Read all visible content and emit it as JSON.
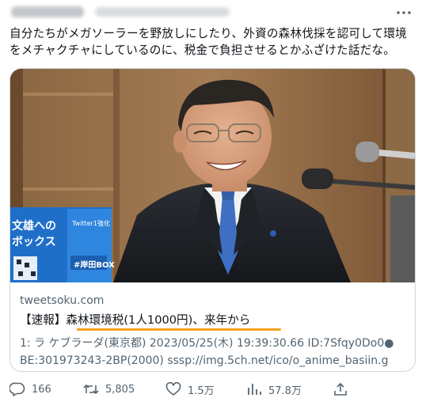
{
  "tweet": {
    "text": "自分たちがメガソーラーを野放しにしたり、外資の森林伐採を認可して環境\nをメチャクチャにしているのに、税金で負担させるとかふざけた話だな。"
  },
  "card": {
    "image": {
      "sign_line1": "文雄への",
      "sign_line2": "ボックス",
      "sign_badge": "Twitter1強化",
      "sign_box": "#岸田BOX"
    },
    "domain": "tweetsoku.com",
    "title": "【速報】森林環境税(1人1000円)、来年から",
    "description": "1: ラ ケブラーダ(東京都) 2023/05/25(木) 19:39:30.66 ID:7Sfqy0Do0●\nBE:301973243-2BP(2000) sssp://img.5ch.net/ico/o_anime_basiin.g",
    "highlight_color": "#f5a01a"
  },
  "actions": {
    "reply_count": "166",
    "retweet_count": "5,805",
    "like_count": "1.5万",
    "view_count": "57.8万"
  },
  "icons": {
    "more": "more-icon",
    "reply": "reply-icon",
    "retweet": "retweet-icon",
    "like": "like-icon",
    "views": "views-icon",
    "share": "share-icon"
  }
}
